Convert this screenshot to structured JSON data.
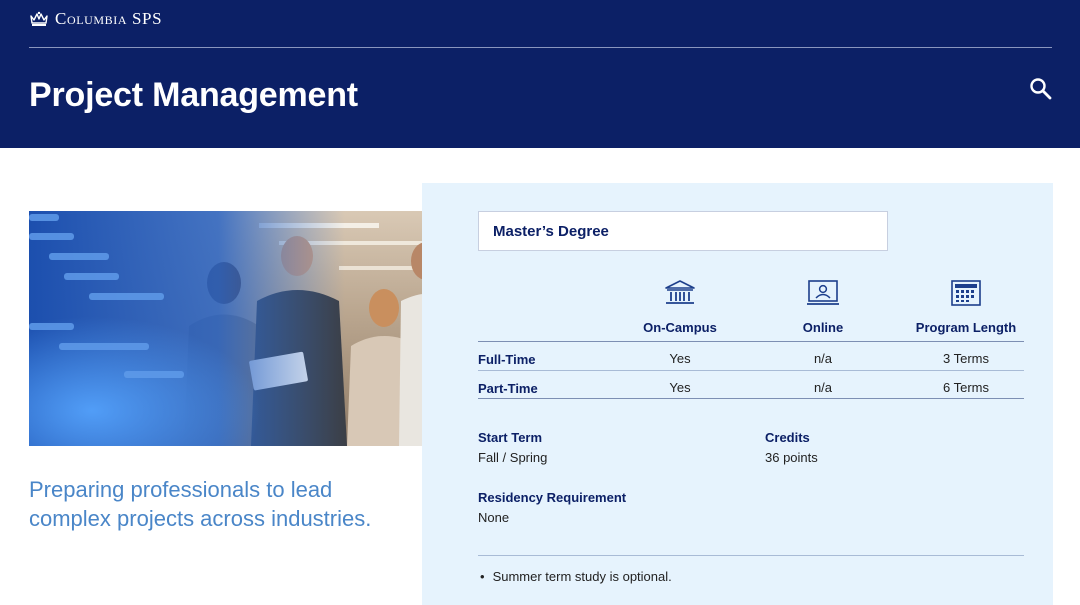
{
  "header": {
    "brand": "Columbia SPS",
    "title": "Project Management"
  },
  "main": {
    "tagline": "Preparing professionals to lead complex projects across industries."
  },
  "program": {
    "degree": "Master’s Degree",
    "columns": [
      {
        "label": "On-Campus",
        "icon": "campus-building-icon"
      },
      {
        "label": "Online",
        "icon": "online-laptop-icon"
      },
      {
        "label": "Program Length",
        "icon": "calendar-icon"
      }
    ],
    "rows": [
      {
        "label": "Full-Time",
        "values": [
          "Yes",
          "n/a",
          "3 Terms"
        ]
      },
      {
        "label": "Part-Time",
        "values": [
          "Yes",
          "n/a",
          "6 Terms"
        ]
      }
    ],
    "details": {
      "start_term_label": "Start Term",
      "start_term_value": "Fall / Spring",
      "credits_label": "Credits",
      "credits_value": "36 points",
      "residency_label": "Residency Requirement",
      "residency_value": "None"
    },
    "note": "Summer term study is optional."
  },
  "colors": {
    "navy": "#0c2066",
    "panel": "#e6f3fd",
    "tagline": "#4a86c8"
  }
}
